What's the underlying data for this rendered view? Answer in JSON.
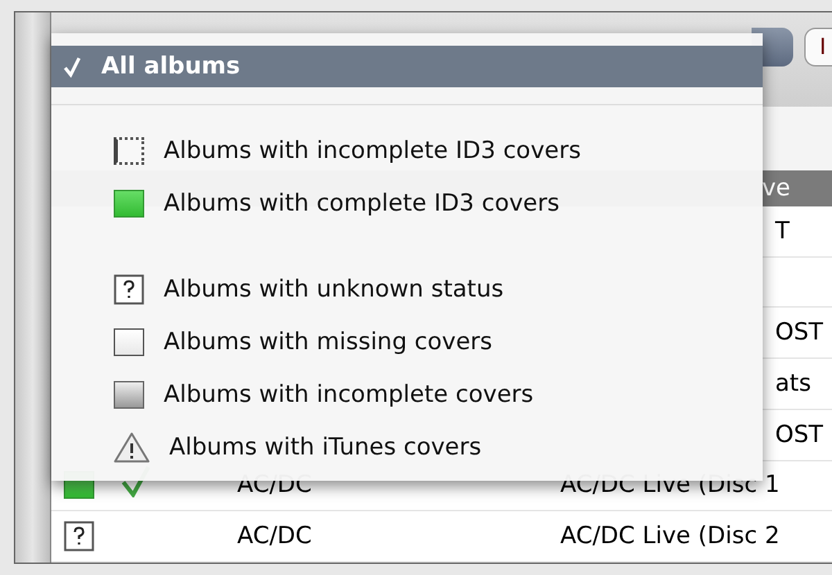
{
  "toolbar": {
    "button_label": "I"
  },
  "table": {
    "header_fragment": "ve",
    "rows": [
      {
        "kind": "covered",
        "album": "T"
      },
      {
        "kind": "blank"
      },
      {
        "kind": "covered",
        "album": "OST"
      },
      {
        "kind": "covered",
        "album": "ats"
      },
      {
        "kind": "covered",
        "album": "OST"
      },
      {
        "kind": "complete",
        "checked": true,
        "artist": "AC/DC",
        "album": "AC/DC Live (Disc 1"
      },
      {
        "kind": "unknown",
        "checked": false,
        "artist": "AC/DC",
        "album": "AC/DC Live (Disc 2"
      }
    ]
  },
  "menu": {
    "items": [
      {
        "kind": "plain",
        "label": "All albums",
        "selected": true
      },
      {
        "kind": "separator"
      },
      {
        "kind": "incomplete_id3",
        "label": "Albums with incomplete ID3 covers",
        "selected": false
      },
      {
        "kind": "complete",
        "label": "Albums with complete ID3 covers",
        "selected": false
      },
      {
        "kind": "separator"
      },
      {
        "kind": "unknown",
        "label": "Albums with unknown status",
        "selected": false
      },
      {
        "kind": "missing",
        "label": "Albums with missing covers",
        "selected": false
      },
      {
        "kind": "incomplete",
        "label": "Albums with incomplete covers",
        "selected": false
      },
      {
        "kind": "itunes",
        "label": "Albums with iTunes covers",
        "selected": false
      }
    ]
  }
}
